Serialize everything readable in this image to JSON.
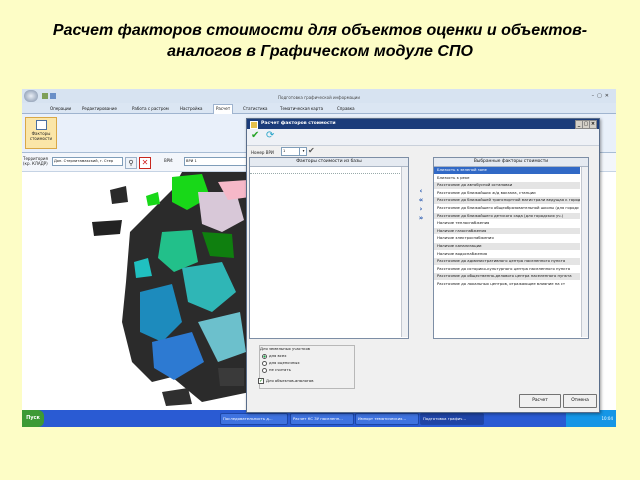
{
  "slide_title": "Расчет факторов стоимости для объектов оценки и объектов-аналогов в Графическом модуле СПО",
  "app": {
    "window_title": "Подготовка графической информации",
    "tabs": [
      "Операции",
      "Редактирование",
      "Работа с растром",
      "Настройка",
      "Расчет",
      "Статистика",
      "Тематическая карта",
      "Справка"
    ],
    "active_tab": "Расчет"
  },
  "ribbon": {
    "factors_button": "Факторы стоимости"
  },
  "filter": {
    "territory_label": "Территория (кр. КЛАДР)",
    "territory_value": "Доп. Стерлитамакский, г. Стер",
    "vri_label": "ВРИ:",
    "vri_value": "ВРИ 1"
  },
  "dialog": {
    "title": "Расчет факторов стоимости",
    "vri_number_label": "Номер ВРИ",
    "vri_number_value": "1",
    "left_header": "Факторы стоимости из базы",
    "right_header": "Выбранные факторы стоимости",
    "selected_factors": [
      "Близость к зеленой зоне",
      "Близость к реке",
      "Расстояние до автобусной остановки",
      "Расстояние до ближайших ж/д вокзала, станции",
      "Расстояние до ближайшей транспортной магистрали ведущая к городу",
      "Расстояние до ближайшего общеобразовательной школы (для городс",
      "Расстояние до ближайшего детского сада (для городских уч.)",
      "Наличие теплоснабжения",
      "Наличие газоснабжения",
      "Наличие электроснабжения",
      "Наличие канализации",
      "Наличие водоснабжения",
      "Расстояние до административного центра населенного пункта",
      "Расстояние до историко-культурного центра населенного пункта",
      "Расстояние до общественно-делового центра населенного пункта",
      "Расстояние до локальных центров, отражающее влияние на ст"
    ],
    "group_label": "Для земельных участков",
    "radios": [
      "для всех",
      "для оценочных",
      "не считать"
    ],
    "checkbox_label": "Для объектов-аналогов",
    "calc_button": "Расчет",
    "cancel_button": "Отмена"
  },
  "taskbar": {
    "start": "Пуск",
    "items": [
      "Последовательность д...",
      "Расчет КС ЗУ населенн...",
      "Импорт тематических...",
      "Подготовка графич..."
    ],
    "clock": "10:04"
  },
  "colors": {
    "background": "#fdfdc6",
    "dialog_title": "#1b3c7a",
    "selection": "#3169c6"
  }
}
